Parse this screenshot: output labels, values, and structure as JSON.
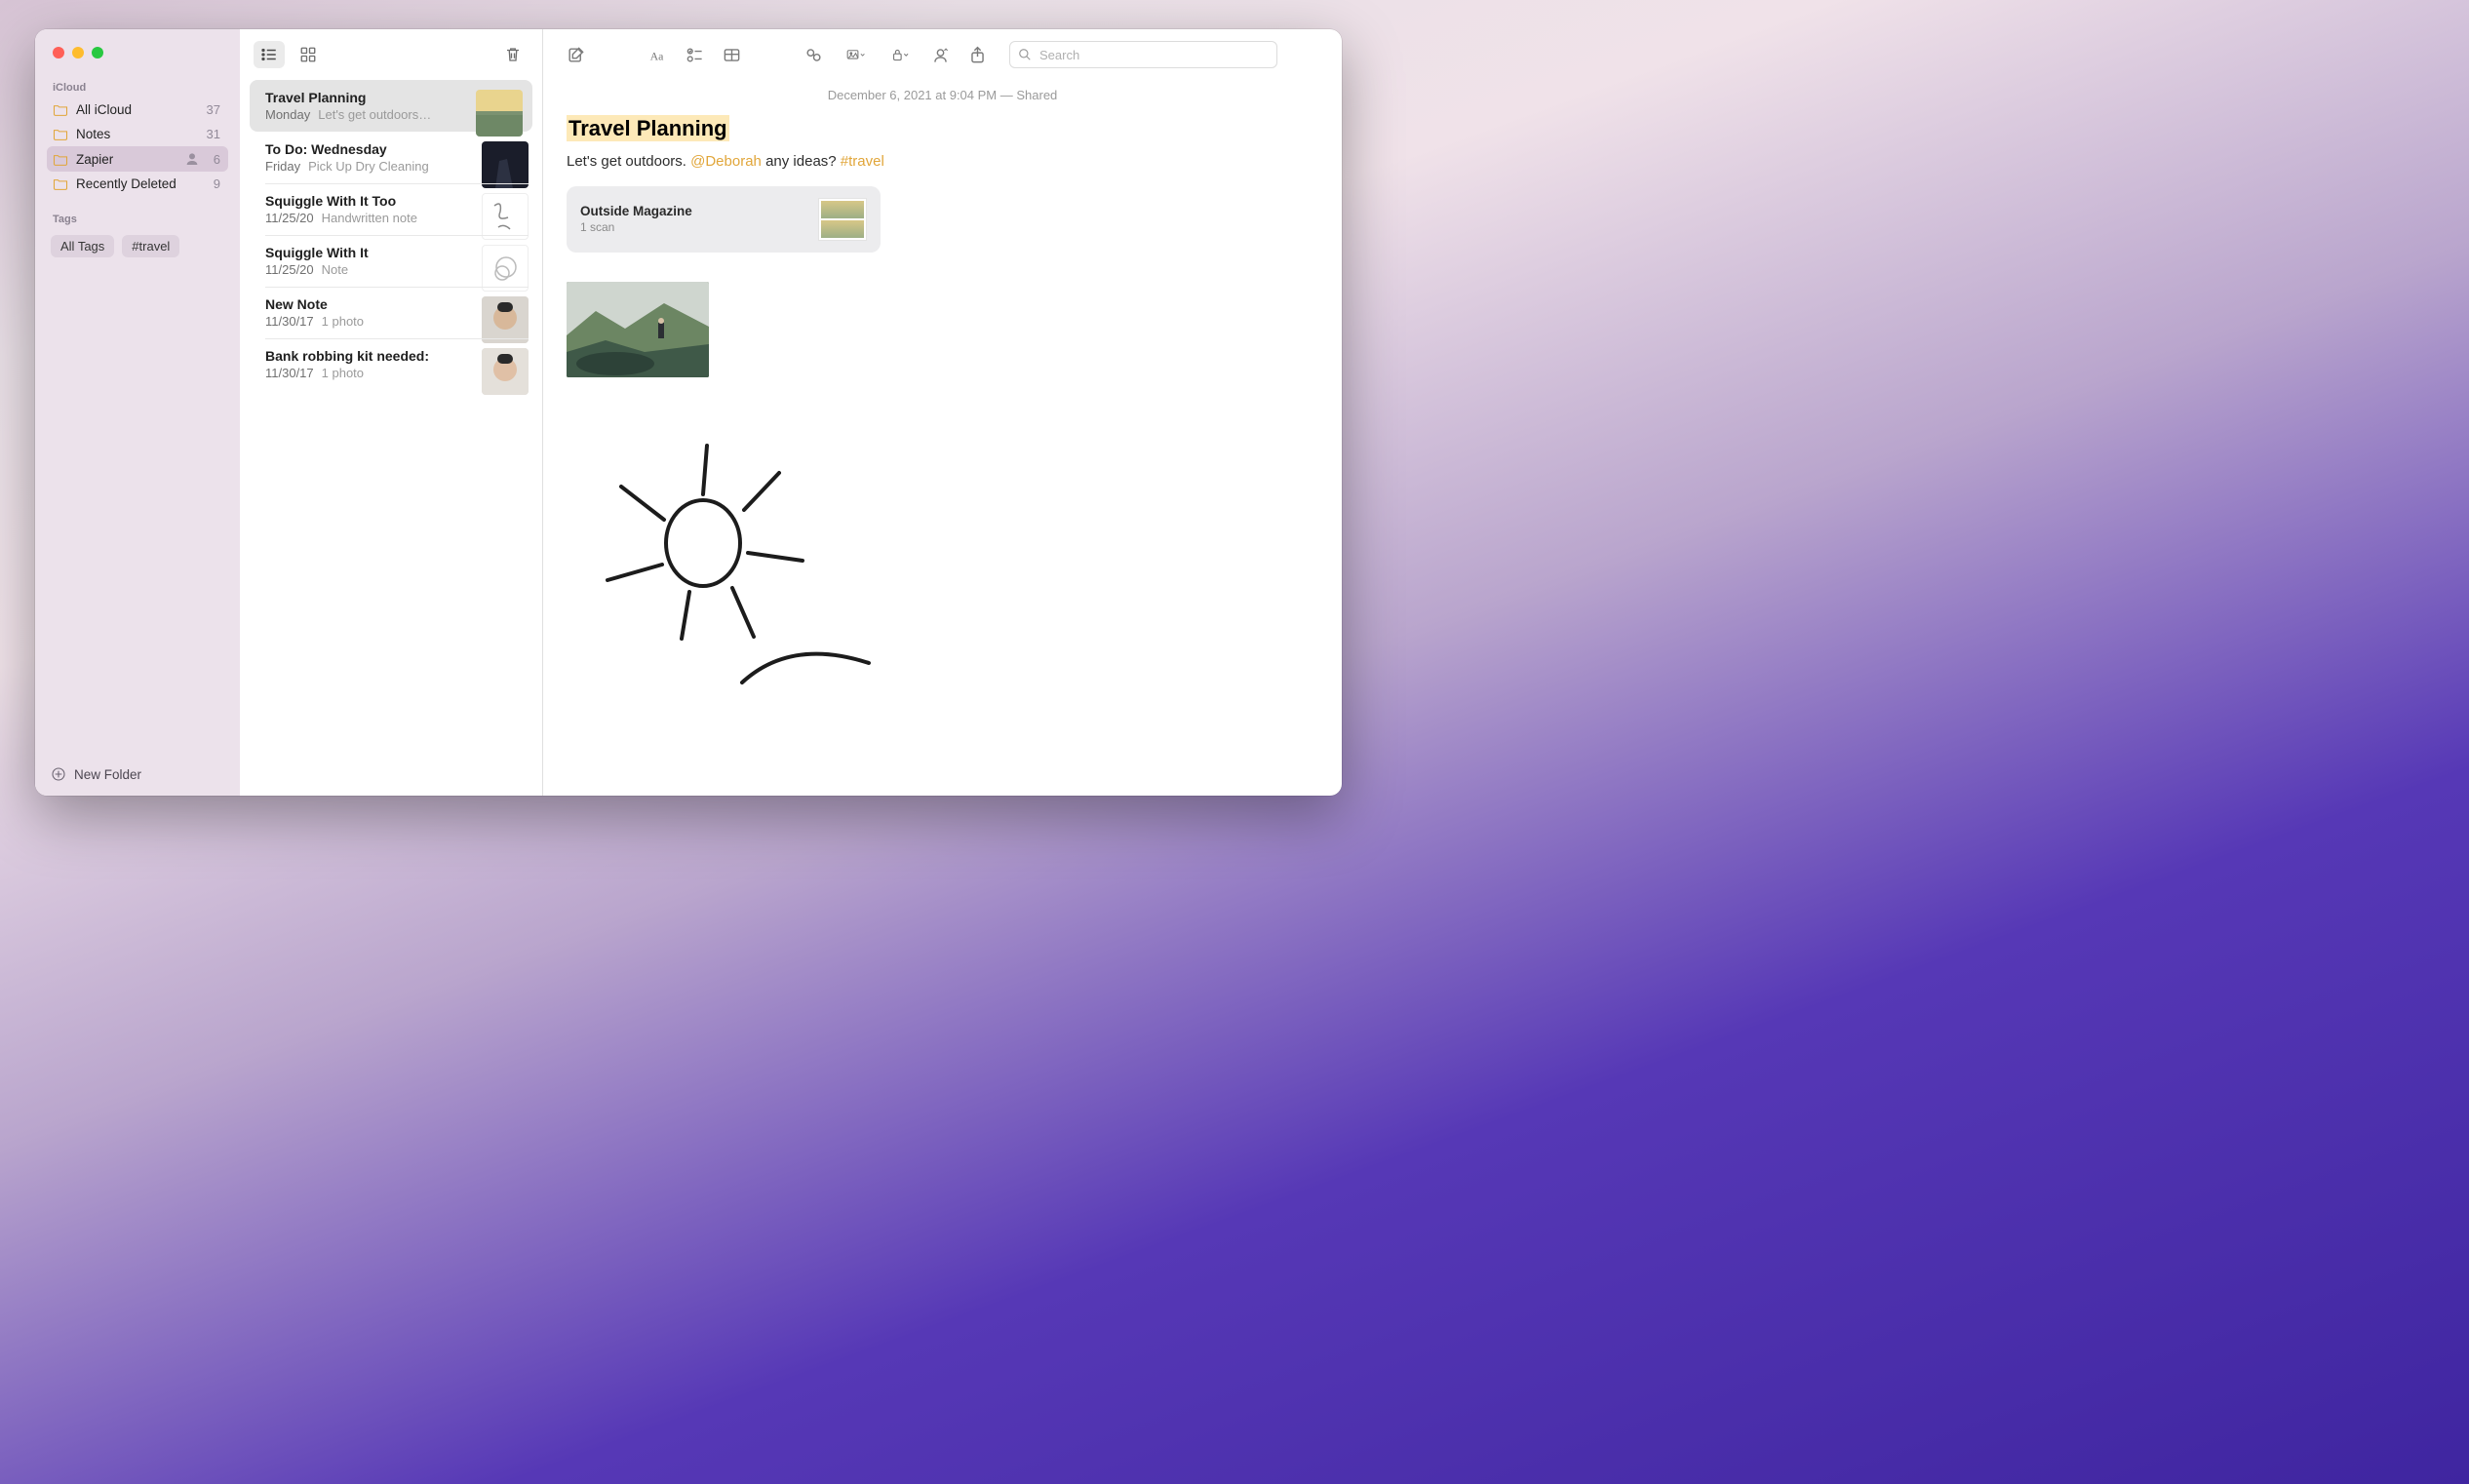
{
  "sidebar": {
    "section_cloud": "iCloud",
    "section_tags": "Tags",
    "folders": [
      {
        "name": "All iCloud",
        "count": "37"
      },
      {
        "name": "Notes",
        "count": "31"
      },
      {
        "name": "Zapier",
        "count": "6",
        "shared": true
      },
      {
        "name": "Recently Deleted",
        "count": "9"
      }
    ],
    "tags": [
      {
        "label": "All Tags"
      },
      {
        "label": "#travel"
      }
    ],
    "new_folder": "New Folder"
  },
  "notes_list": [
    {
      "title": "Travel Planning",
      "date": "Monday",
      "preview": "Let's get outdoors…"
    },
    {
      "title": "To Do: Wednesday",
      "date": "Friday",
      "preview": "Pick Up Dry Cleaning"
    },
    {
      "title": "Squiggle With It Too",
      "date": "11/25/20",
      "preview": "Handwritten note"
    },
    {
      "title": "Squiggle With It",
      "date": "11/25/20",
      "preview": "Note"
    },
    {
      "title": "New Note",
      "date": "11/30/17",
      "preview": "1 photo"
    },
    {
      "title": "Bank robbing kit needed:",
      "date": "11/30/17",
      "preview": "1 photo"
    }
  ],
  "detail": {
    "meta": "December 6, 2021 at 9:04 PM — Shared",
    "title": "Travel Planning",
    "body_pre": "Let's get outdoors. ",
    "mention": "@Deborah",
    "body_mid": " any ideas? ",
    "hashtag": "#travel",
    "attachment": {
      "title": "Outside Magazine",
      "sub": "1 scan"
    }
  },
  "search_placeholder": "Search"
}
